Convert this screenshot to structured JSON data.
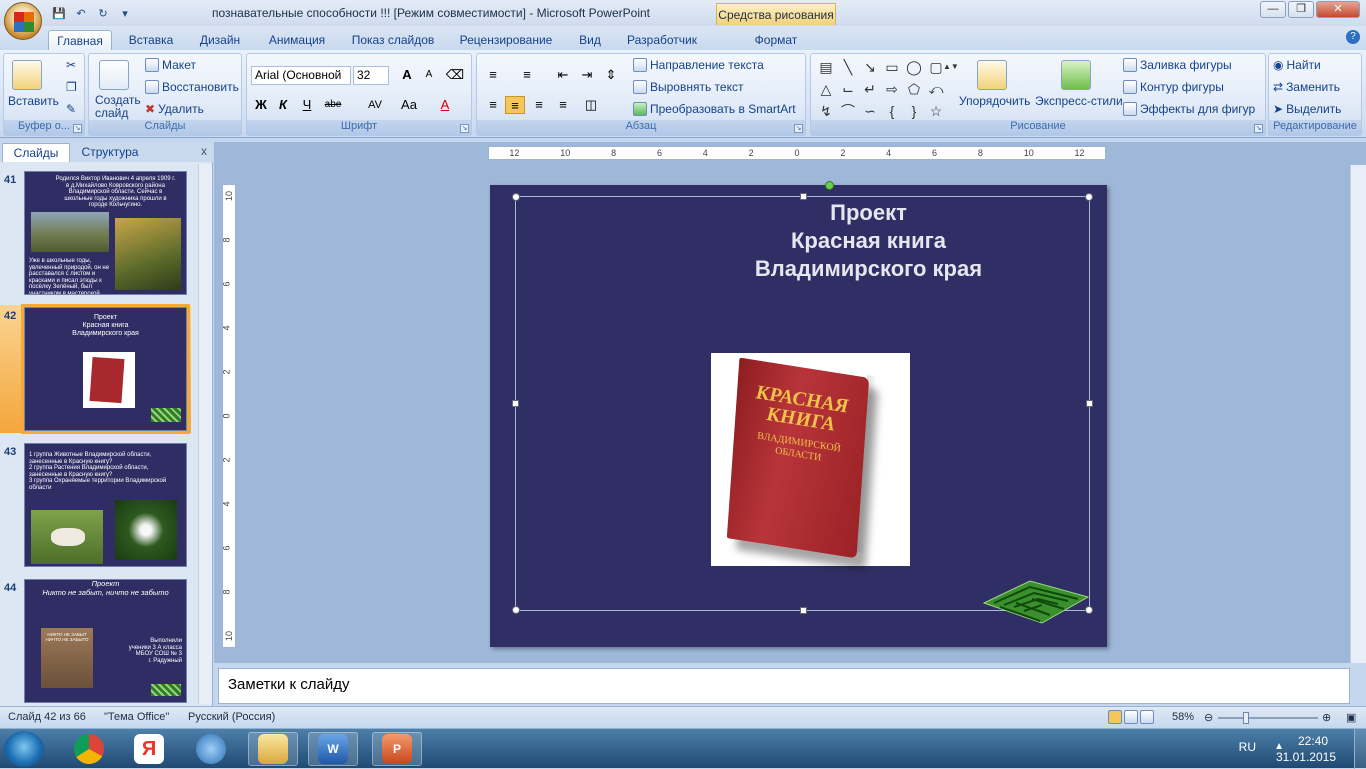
{
  "window": {
    "title": "познавательные способности !!! [Режим совместимости] - Microsoft PowerPoint",
    "context_tab": "Средства рисования"
  },
  "tabs": [
    "Главная",
    "Вставка",
    "Дизайн",
    "Анимация",
    "Показ слайдов",
    "Рецензирование",
    "Вид",
    "Разработчик",
    "Формат"
  ],
  "ribbon": {
    "clipboard": {
      "paste": "Вставить",
      "label": "Буфер о..."
    },
    "slides": {
      "new_slide": "Создать слайд",
      "layout": "Макет",
      "reset": "Восстановить",
      "delete": "Удалить",
      "label": "Слайды"
    },
    "font": {
      "name": "Arial (Основной",
      "size": "32",
      "bold": "Ж",
      "italic": "К",
      "underline": "Ч",
      "strike": "abe",
      "spacing": "AV",
      "case": "Aa",
      "color": "A",
      "grow": "A",
      "shrink": "A",
      "label": "Шрифт"
    },
    "paragraph": {
      "text_direction": "Направление текста",
      "align_text": "Выровнять текст",
      "smartart": "Преобразовать в SmartArt",
      "label": "Абзац"
    },
    "drawing": {
      "arrange": "Упорядочить",
      "quick_styles": "Экспресс-стили",
      "fill": "Заливка фигуры",
      "outline": "Контур фигуры",
      "effects": "Эффекты для фигур",
      "label": "Рисование"
    },
    "editing": {
      "find": "Найти",
      "replace": "Заменить",
      "select": "Выделить",
      "label": "Редактирование"
    }
  },
  "left_pane": {
    "tab_slides": "Слайды",
    "tab_outline": "Структура",
    "close": "x",
    "thumbnails": [
      {
        "num": "41",
        "text": "Родился Виктор Иванович 4 апреля 1909 г. в д.Михайлово Ковровского района Владимирской области. Сейчас в школьные годы художника прошли в городе Кольчугино.",
        "text2": "Уже в школьные годы, увлеченный природой, он не расставался с листом и красками и писал этюды к посёлку Зелёный, был участником в мастерской художника."
      },
      {
        "num": "42",
        "text": "Проект\nКрасная книга\nВладимирского края"
      },
      {
        "num": "43",
        "text": "1 группа Животные Владимирской области, занесенные в Красную книгу?\n2 группа Растения Владимирской области, занесенные в Красную книгу?\n3 группа Охраняемые территории Владимирской области"
      },
      {
        "num": "44",
        "text": "Проект\nНикто не забыт, ничто не забыто",
        "text2": "Выполнили\nученики 3 А класса\nМБОУ СОШ № 3\nг. Радужный",
        "plaque": "НИКТО НЕ ЗАБЫТ\nНИЧТО НЕ ЗАБЫТО"
      }
    ]
  },
  "slide": {
    "title": "Проект\nКрасная книга\nВладимирского края",
    "book_title": "КРАСНАЯ\nКНИГА",
    "book_subtitle": "ВЛАДИМИРСКОЙ\nОБЛАСТИ"
  },
  "notes": {
    "placeholder": "Заметки к слайду"
  },
  "ruler": {
    "h_ticks": [
      "12",
      "10",
      "8",
      "6",
      "4",
      "2",
      "0",
      "2",
      "4",
      "6",
      "8",
      "10",
      "12"
    ],
    "v_ticks": [
      "10",
      "8",
      "6",
      "4",
      "2",
      "0",
      "2",
      "4",
      "6",
      "8",
      "10"
    ]
  },
  "status": {
    "slide": "Слайд 42 из 66",
    "theme": "\"Тема Office\"",
    "lang": "Русский (Россия)",
    "zoom": "58%"
  },
  "taskbar": {
    "lang": "RU",
    "time": "22:40",
    "date": "31.01.2015"
  },
  "colors": {
    "slide_bg": "#302f65",
    "accent": "#f6a93b"
  }
}
